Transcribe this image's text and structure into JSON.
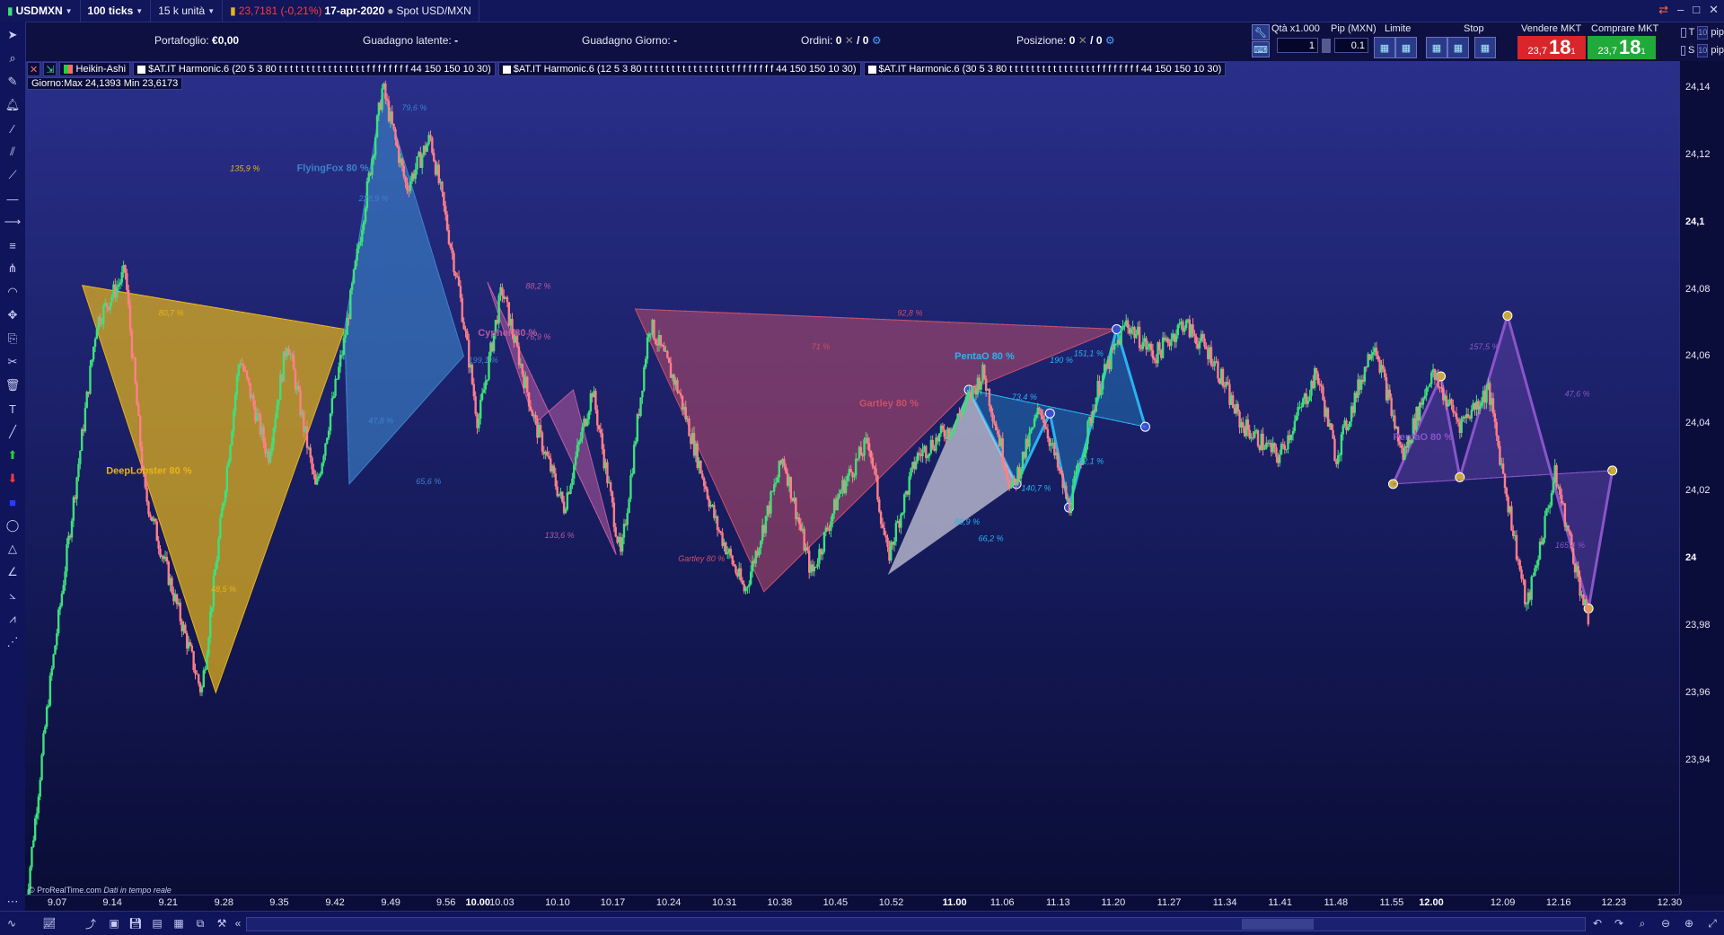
{
  "topbar": {
    "symbol": "USDMXN",
    "ticks": "100 ticks",
    "units": "15 k unità",
    "price_change": "23,7181 (-0,21%)",
    "date": "17-apr-2020",
    "instrument": "Spot USD/MXN"
  },
  "infobar": {
    "portfolio_label": "Portafoglio:",
    "portfolio_value": "€0,00",
    "latent_label": "Guadagno latente:",
    "latent_value": "-",
    "day_label": "Guadagno Giorno:",
    "day_value": "-",
    "orders_label": "Ordini:",
    "orders_value": "0",
    "orders_total": "/ 0",
    "position_label": "Posizione:",
    "position_value": "0",
    "position_total": "/ 0"
  },
  "trade": {
    "qty_label": "Qtà x1.000",
    "qty_value": "1",
    "pip_label": "Pip (MXN)",
    "pip_value": "0.1",
    "limit_label": "Limite",
    "stop_label": "Stop",
    "sell_label": "Vendere MKT",
    "sell_small": "23,7",
    "sell_big": "18",
    "sell_sup": "1",
    "buy_label": "Comprare MKT",
    "buy_small": "23,7",
    "buy_big": "18",
    "buy_sup": "1"
  },
  "rightctl": {
    "t_label": "T",
    "s_label": "S",
    "pip_value": "10",
    "pip_unit": "pip"
  },
  "indicators": [
    "Heikin-Ashi",
    "$AT.IT Harmonic.6 (20 5 3 80 t t t t t t t t t t t t t t t t f f f f f f f f 44 150 150 10 30)",
    "$AT.IT Harmonic.6 (12 5 3 80 t t t t t t t t t t t t t t t t f f f f f f f f 44 150 150 10 30)",
    "$AT.IT Harmonic.6 (30 5 3 80 t t t t t t t t t t t t t t t t f f f f f f f f 44 150 150 10 30)"
  ],
  "daybox": "Giorno:Max 24,1393 Min 23,6173",
  "credit": {
    "brand": "© ProRealTime.com",
    "note": "Dati in tempo reale"
  },
  "colors": {
    "up": "#3ee07a",
    "down": "#ff7f8a",
    "deeplobster": "#e6b41a",
    "flyingfox": "#3b82c8",
    "cypher": "#b85aa0",
    "gartley": "#c8506a",
    "pentao_blue": "#27b4f0",
    "pentao_purple": "#8a55c8",
    "background": "#0d1040"
  },
  "chart_data": {
    "type": "candlestick",
    "y_axis": {
      "range": [
        23.9,
        24.15
      ],
      "ticks": [
        {
          "v": 24.14,
          "label": "24,14",
          "bold": false
        },
        {
          "v": 24.12,
          "label": "24,12",
          "bold": false
        },
        {
          "v": 24.1,
          "label": "24,1",
          "bold": true
        },
        {
          "v": 24.08,
          "label": "24,08",
          "bold": false
        },
        {
          "v": 24.06,
          "label": "24,06",
          "bold": false
        },
        {
          "v": 24.04,
          "label": "24,04",
          "bold": false
        },
        {
          "v": 24.02,
          "label": "24,02",
          "bold": false
        },
        {
          "v": 24.0,
          "label": "24",
          "bold": true
        },
        {
          "v": 23.98,
          "label": "23,98",
          "bold": false
        },
        {
          "v": 23.96,
          "label": "23,96",
          "bold": false
        },
        {
          "v": 23.94,
          "label": "23,94",
          "bold": false
        }
      ]
    },
    "x_axis": {
      "range": [
        9.05,
        12.33
      ],
      "ticks": [
        {
          "t": 9.117,
          "label": "9.07",
          "bold": false
        },
        {
          "t": 9.233,
          "label": "9.14",
          "bold": false
        },
        {
          "t": 9.35,
          "label": "9.21",
          "bold": false
        },
        {
          "t": 9.467,
          "label": "9.28",
          "bold": false
        },
        {
          "t": 9.583,
          "label": "9.35",
          "bold": false
        },
        {
          "t": 9.7,
          "label": "9.42",
          "bold": false
        },
        {
          "t": 9.817,
          "label": "9.49",
          "bold": false
        },
        {
          "t": 9.933,
          "label": "9.56",
          "bold": false
        },
        {
          "t": 10.0,
          "label": "10.00",
          "bold": true
        },
        {
          "t": 10.05,
          "label": "10.03",
          "bold": false
        },
        {
          "t": 10.167,
          "label": "10.10",
          "bold": false
        },
        {
          "t": 10.283,
          "label": "10.17",
          "bold": false
        },
        {
          "t": 10.4,
          "label": "10.24",
          "bold": false
        },
        {
          "t": 10.517,
          "label": "10.31",
          "bold": false
        },
        {
          "t": 10.633,
          "label": "10.38",
          "bold": false
        },
        {
          "t": 10.75,
          "label": "10.45",
          "bold": false
        },
        {
          "t": 10.867,
          "label": "10.52",
          "bold": false
        },
        {
          "t": 11.0,
          "label": "11.00",
          "bold": true
        },
        {
          "t": 11.1,
          "label": "11.06",
          "bold": false
        },
        {
          "t": 11.217,
          "label": "11.13",
          "bold": false
        },
        {
          "t": 11.333,
          "label": "11.20",
          "bold": false
        },
        {
          "t": 11.45,
          "label": "11.27",
          "bold": false
        },
        {
          "t": 11.567,
          "label": "11.34",
          "bold": false
        },
        {
          "t": 11.683,
          "label": "11.41",
          "bold": false
        },
        {
          "t": 11.8,
          "label": "11.48",
          "bold": false
        },
        {
          "t": 11.917,
          "label": "11.55",
          "bold": false
        },
        {
          "t": 12.0,
          "label": "12.00",
          "bold": true
        },
        {
          "t": 12.15,
          "label": "12.09",
          "bold": false
        },
        {
          "t": 12.267,
          "label": "12.16",
          "bold": false
        },
        {
          "t": 12.383,
          "label": "12.23",
          "bold": false
        },
        {
          "t": 12.5,
          "label": "12.30",
          "bold": false
        }
      ]
    },
    "price_path": [
      [
        9.05,
        23.895
      ],
      [
        9.1,
        23.96
      ],
      [
        9.2,
        24.07
      ],
      [
        9.26,
        24.085
      ],
      [
        9.3,
        24.02
      ],
      [
        9.36,
        23.99
      ],
      [
        9.42,
        23.96
      ],
      [
        9.5,
        24.06
      ],
      [
        9.56,
        24.03
      ],
      [
        9.6,
        24.065
      ],
      [
        9.66,
        24.02
      ],
      [
        9.72,
        24.065
      ],
      [
        9.8,
        24.14
      ],
      [
        9.85,
        24.11
      ],
      [
        9.9,
        24.125
      ],
      [
        9.96,
        24.08
      ],
      [
        10.0,
        24.04
      ],
      [
        10.05,
        24.08
      ],
      [
        10.12,
        24.04
      ],
      [
        10.18,
        24.015
      ],
      [
        10.24,
        24.05
      ],
      [
        10.3,
        24.0
      ],
      [
        10.36,
        24.07
      ],
      [
        10.42,
        24.05
      ],
      [
        10.5,
        24.01
      ],
      [
        10.56,
        23.99
      ],
      [
        10.64,
        24.03
      ],
      [
        10.7,
        23.995
      ],
      [
        10.76,
        24.02
      ],
      [
        10.82,
        24.035
      ],
      [
        10.86,
        24.0
      ],
      [
        10.92,
        24.03
      ],
      [
        11.0,
        24.04
      ],
      [
        11.06,
        24.055
      ],
      [
        11.12,
        24.02
      ],
      [
        11.18,
        24.045
      ],
      [
        11.24,
        24.015
      ],
      [
        11.3,
        24.05
      ],
      [
        11.36,
        24.07
      ],
      [
        11.42,
        24.06
      ],
      [
        11.48,
        24.07
      ],
      [
        11.54,
        24.06
      ],
      [
        11.6,
        24.04
      ],
      [
        11.68,
        24.03
      ],
      [
        11.76,
        24.055
      ],
      [
        11.8,
        24.03
      ],
      [
        11.88,
        24.065
      ],
      [
        11.94,
        24.03
      ],
      [
        12.0,
        24.055
      ],
      [
        12.06,
        24.04
      ],
      [
        12.12,
        24.05
      ],
      [
        12.2,
        23.985
      ],
      [
        12.26,
        24.025
      ],
      [
        12.33,
        23.98
      ]
    ],
    "patterns": [
      {
        "name": "DeepLobster",
        "color": "#e6b41a",
        "opacity": 0.85,
        "points": [
          [
            9.17,
            24.081
          ],
          [
            9.45,
            23.96
          ],
          [
            9.72,
            24.068
          ]
        ],
        "label": "DeepLobster 80 %",
        "label_at": [
          9.22,
          24.025
        ],
        "ratios": [
          {
            "text": "80,7 %",
            "at": [
              9.33,
              24.072
            ]
          },
          {
            "text": "48,5 %",
            "at": [
              9.44,
              23.99
            ]
          },
          {
            "text": "135,9 %",
            "at": [
              9.48,
              24.115
            ]
          }
        ]
      },
      {
        "name": "FlyingFox",
        "color": "#3b82c8",
        "opacity": 0.75,
        "points": [
          [
            9.72,
            24.068
          ],
          [
            9.8,
            24.139
          ],
          [
            9.97,
            24.06
          ],
          [
            9.73,
            24.022
          ]
        ],
        "label": "FlyingFox 80 %",
        "label_at": [
          9.62,
          24.115
        ],
        "ratios": [
          {
            "text": "228,9 %",
            "at": [
              9.75,
              24.106
            ]
          },
          {
            "text": "79,6 %",
            "at": [
              9.84,
              24.133
            ]
          },
          {
            "text": "47,8 %",
            "at": [
              9.77,
              24.04
            ]
          },
          {
            "text": "199,1 %",
            "at": [
              9.98,
              24.058
            ]
          },
          {
            "text": "65,6 %",
            "at": [
              9.87,
              24.022
            ]
          }
        ]
      },
      {
        "name": "Cypher",
        "color": "#b85aa0",
        "opacity": 0.65,
        "points": [
          [
            10.02,
            24.082
          ],
          [
            10.12,
            24.04
          ],
          [
            10.2,
            24.05
          ],
          [
            10.29,
            24.001
          ]
        ],
        "label": "Cypher 80 %",
        "label_at": [
          10.0,
          24.066
        ],
        "ratios": [
          {
            "text": "88,2 %",
            "at": [
              10.1,
              24.08
            ]
          },
          {
            "text": "76,9 %",
            "at": [
              10.1,
              24.065
            ]
          },
          {
            "text": "133,6 %",
            "at": [
              10.14,
              24.006
            ]
          }
        ]
      },
      {
        "name": "Gartley",
        "color": "#c8506a",
        "opacity": 0.6,
        "points": [
          [
            10.33,
            24.074
          ],
          [
            10.6,
            23.99
          ],
          [
            11.03,
            24.05
          ],
          [
            11.34,
            24.068
          ]
        ],
        "label": "Gartley 80 %",
        "label_at": [
          10.8,
          24.045
        ],
        "ratios": [
          {
            "text": "92,8 %",
            "at": [
              10.88,
              24.072
            ]
          },
          {
            "text": "71 %",
            "at": [
              10.7,
              24.062
            ]
          },
          {
            "text": "Gartley 80 %",
            "at": [
              10.42,
              23.999
            ]
          }
        ]
      },
      {
        "name": "PentaO-blue",
        "color": "#27b4f0",
        "opacity": 0.35,
        "points": [
          [
            11.03,
            24.05
          ],
          [
            11.13,
            24.022
          ],
          [
            11.2,
            24.043
          ],
          [
            11.24,
            24.015
          ],
          [
            11.34,
            24.068
          ],
          [
            11.4,
            24.039
          ]
        ],
        "label": "PentaO 80 %",
        "label_at": [
          11.0,
          24.059
        ],
        "ratios": [
          {
            "text": "73,4 %",
            "at": [
              11.12,
              24.047
            ]
          },
          {
            "text": "140,7 %",
            "at": [
              11.14,
              24.02
            ]
          },
          {
            "text": "190 %",
            "at": [
              11.2,
              24.058
            ]
          },
          {
            "text": "151,1 %",
            "at": [
              11.25,
              24.06
            ]
          },
          {
            "text": "52,1 %",
            "at": [
              11.26,
              24.028
            ]
          },
          {
            "text": "66,2 %",
            "at": [
              11.05,
              24.005
            ]
          },
          {
            "text": "80,9 %",
            "at": [
              11.0,
              24.01
            ]
          }
        ]
      },
      {
        "name": "PentaO-purple",
        "color": "#8a55c8",
        "opacity": 0.35,
        "points": [
          [
            11.92,
            24.022
          ],
          [
            12.02,
            24.054
          ],
          [
            12.06,
            24.024
          ],
          [
            12.16,
            24.072
          ],
          [
            12.33,
            23.985
          ],
          [
            12.38,
            24.026
          ]
        ],
        "label": "PentaO 80 %",
        "label_at": [
          11.92,
          24.035
        ],
        "ratios": [
          {
            "text": "157,5 %",
            "at": [
              12.08,
              24.062
            ]
          },
          {
            "text": "47,6 %",
            "at": [
              12.28,
              24.048
            ]
          },
          {
            "text": "165,4 %",
            "at": [
              12.26,
              24.003
            ]
          }
        ]
      }
    ],
    "triangle_gray": {
      "points": [
        [
          10.86,
          23.995
        ],
        [
          11.03,
          24.05
        ],
        [
          11.13,
          24.022
        ]
      ],
      "color": "#c8c8d8"
    }
  }
}
